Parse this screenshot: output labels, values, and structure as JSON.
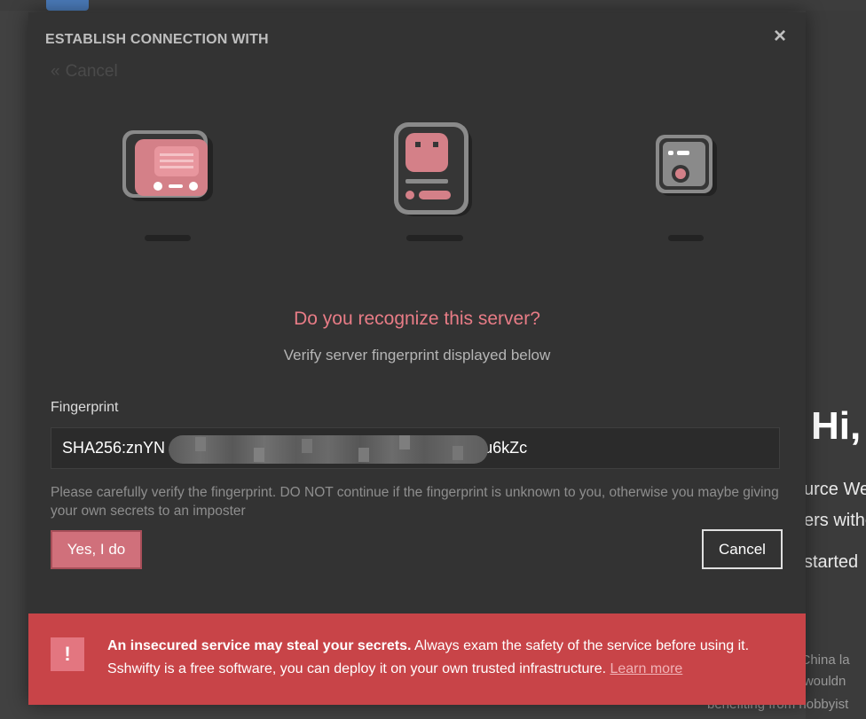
{
  "background": {
    "greeting": "Hi,",
    "lines": [
      "urce We",
      "ers witho",
      "started"
    ],
    "footer_lines": [
      "n China la",
      "ty wouldn",
      "benefiting from hobbyist"
    ]
  },
  "dialog": {
    "title": "ESTABLISH CONNECTION WITH",
    "close_icon": "×",
    "back_label": "Cancel",
    "back_icon": "«",
    "illustrations": [
      "client-terminal-icon",
      "robot-server-icon",
      "remote-device-icon"
    ],
    "question": "Do you recognize this server?",
    "subtitle": "Verify server fingerprint displayed below",
    "fingerprint_label": "Fingerprint",
    "fingerprint_prefix": "SHA256:znYN",
    "fingerprint_suffix": "u6kZc",
    "warning": "Please carefully verify the fingerprint. DO NOT continue if the fingerprint is unknown to you, otherwise you maybe giving your own secrets to an imposter",
    "yes_button": "Yes, I do",
    "cancel_button": "Cancel"
  },
  "alert": {
    "icon": "!",
    "bold": "An insecured service may steal your secrets.",
    "text": " Always exam the safety of the service before using it. Sshwifty is a free software, you can deploy it on your own trusted infrastructure. ",
    "link": "Learn more"
  },
  "colors": {
    "accent": "#e87c86",
    "button": "#d0707b",
    "alert": "#c84448"
  }
}
